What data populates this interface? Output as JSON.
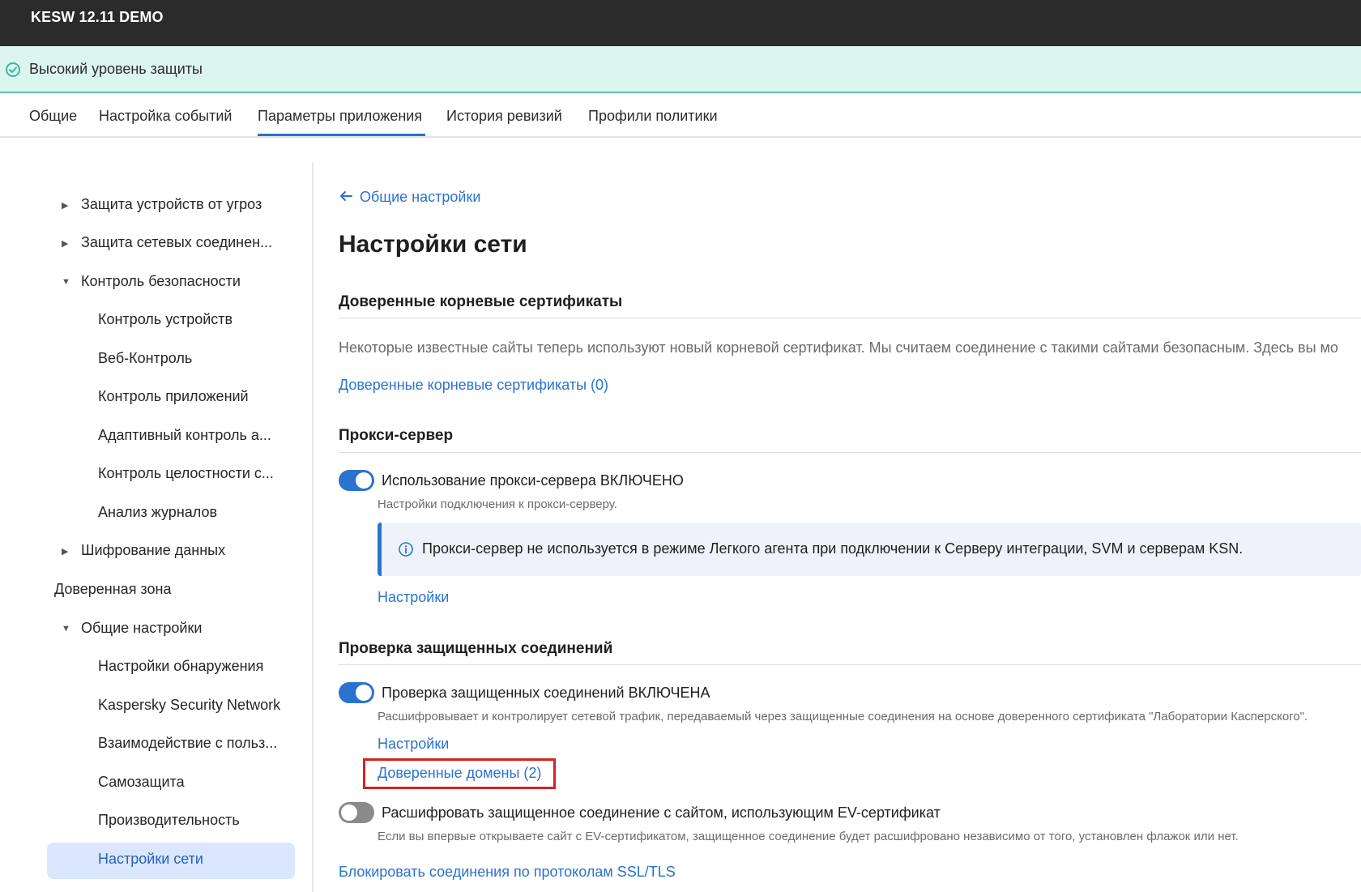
{
  "app": {
    "title": "KESW 12.11 DEMO"
  },
  "status": {
    "text": "Высокий уровень защиты",
    "color": "#3bb79b"
  },
  "tabs": [
    {
      "label": "Общие"
    },
    {
      "label": "Настройка событий"
    },
    {
      "label": "Параметры приложения",
      "active": true
    },
    {
      "label": "История ревизий"
    },
    {
      "label": "Профили политики"
    }
  ],
  "sidebar": {
    "items": [
      {
        "label": "Защита устройств от угроз",
        "arrow": "▶"
      },
      {
        "label": "Защита сетевых соединен...",
        "arrow": "▶"
      },
      {
        "label": "Контроль безопасности",
        "arrow": "▼"
      },
      {
        "label": "Контроль устройств"
      },
      {
        "label": "Веб-Контроль"
      },
      {
        "label": "Контроль приложений"
      },
      {
        "label": "Адаптивный контроль а..."
      },
      {
        "label": "Контроль целостности с..."
      },
      {
        "label": "Анализ журналов"
      },
      {
        "label": "Шифрование данных",
        "arrow": "▶"
      },
      {
        "label": "Доверенная зона"
      },
      {
        "label": "Общие настройки",
        "arrow": "▼"
      },
      {
        "label": "Настройки обнаружения"
      },
      {
        "label": "Kaspersky Security Network"
      },
      {
        "label": "Взаимодействие с польз..."
      },
      {
        "label": "Самозащита"
      },
      {
        "label": "Производительность"
      },
      {
        "label": "Настройки сети",
        "active": true
      }
    ]
  },
  "main": {
    "back_link": "Общие настройки",
    "title": "Настройки сети",
    "root_certs": {
      "heading": "Доверенные корневые сертификаты",
      "description": "Некоторые известные сайты теперь используют новый корневой сертификат. Мы считаем соединение с такими сайтами безопасным. Здесь вы мо",
      "link": "Доверенные корневые сертификаты (0)"
    },
    "proxy": {
      "heading": "Прокси-сервер",
      "toggle_label": "Использование прокси-сервера ВКЛЮЧЕНО",
      "toggle_on": true,
      "hint": "Настройки подключения к прокси-серверу.",
      "info": "Прокси-сервер не используется в режиме Легкого агента при подключении к Серверу интеграции, SVM и серверам KSN.",
      "settings_link": "Настройки"
    },
    "secure_conn": {
      "heading": "Проверка защищенных соединений",
      "toggle_label": "Проверка защищенных соединений ВКЛЮЧЕНА",
      "toggle_on": true,
      "hint": "Расшифровывает и контролирует сетевой трафик, передаваемый через защищенные соединения на основе доверенного сертификата \"Лаборатории Касперского\".",
      "settings_link": "Настройки",
      "trusted_domains_link": "Доверенные домены (2)",
      "ev_toggle_label": "Расшифровать защищенное соединение с сайтом, использующим EV-сертификат",
      "ev_toggle_on": false,
      "ev_hint": "Если вы впервые открываете сайт с EV-сертификатом, защищенное соединение будет расшифровано независимо от того, установлен флажок или нет.",
      "block_link": "Блокировать соединения по протоколам SSL/TLS"
    }
  },
  "colors": {
    "accent": "#2a73ce",
    "header_bg": "#2b2b2b",
    "banner_bg": "#dcf5ef",
    "highlight": "#d32222"
  },
  "icons": {
    "status": "check-circle-icon",
    "back": "arrow-left-icon",
    "info": "info-circle-icon"
  }
}
